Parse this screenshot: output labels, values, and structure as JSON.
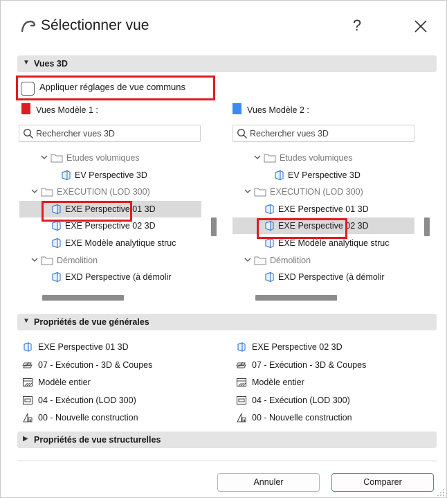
{
  "dialog": {
    "title": "Sélectionner vue",
    "help": "?"
  },
  "section_3d": {
    "label": "Vues 3D"
  },
  "checkbox": {
    "label": "Appliquer réglages de vue communs",
    "checked": false
  },
  "left": {
    "model_label": "Vues Modèle 1 :",
    "swatch_color": "#e11b22",
    "search_placeholder": "Rechercher vues 3D",
    "tree": [
      {
        "type": "folder",
        "label": "Etudes volumiques"
      },
      {
        "type": "view",
        "label": "EV Perspective 3D"
      },
      {
        "type": "folder",
        "label": "EXECUTION (LOD 300)"
      },
      {
        "type": "view",
        "label": "EXE Perspective 01 3D",
        "selected": true
      },
      {
        "type": "view",
        "label": "EXE Perspective 02 3D"
      },
      {
        "type": "view",
        "label": "EXE Modèle analytique struc"
      },
      {
        "type": "folder",
        "label": "Démolition"
      },
      {
        "type": "view",
        "label": "EXD Perspective (à démolir"
      }
    ]
  },
  "right": {
    "model_label": "Vues Modèle 2 :",
    "swatch_color": "#3b8cf0",
    "search_placeholder": "Rechercher vues 3D",
    "tree": [
      {
        "type": "folder",
        "label": "Etudes volumiques"
      },
      {
        "type": "view",
        "label": "EV Perspective 3D"
      },
      {
        "type": "folder",
        "label": "EXECUTION (LOD 300)"
      },
      {
        "type": "view",
        "label": "EXE Perspective 01 3D"
      },
      {
        "type": "view",
        "label": "EXE Perspective 02 3D",
        "selected": true
      },
      {
        "type": "view",
        "label": "EXE Modèle analytique struc"
      },
      {
        "type": "folder",
        "label": "Démolition"
      },
      {
        "type": "view",
        "label": "EXD Perspective (à démolir"
      }
    ]
  },
  "section_general": {
    "label": "Propriétés de vue générales"
  },
  "props_left": [
    {
      "icon": "view-icon",
      "label": "EXE Perspective 01 3D"
    },
    {
      "icon": "layer-combination-icon",
      "label": "07 - Exécution - 3D & Coupes"
    },
    {
      "icon": "model-view-icon",
      "label": "Modèle entier"
    },
    {
      "icon": "pen-set-icon",
      "label": "04 - Exécution (LOD 300)"
    },
    {
      "icon": "renovation-filter-icon",
      "label": "00 - Nouvelle construction"
    }
  ],
  "props_right": [
    {
      "icon": "view-icon",
      "label": "EXE Perspective 02 3D"
    },
    {
      "icon": "layer-combination-icon",
      "label": "07 - Exécution - 3D & Coupes"
    },
    {
      "icon": "model-view-icon",
      "label": "Modèle entier"
    },
    {
      "icon": "pen-set-icon",
      "label": "04 - Exécution (LOD 300)"
    },
    {
      "icon": "renovation-filter-icon",
      "label": "00 - Nouvelle construction"
    }
  ],
  "section_structural": {
    "label": "Propriétés de vue structurelles"
  },
  "buttons": {
    "cancel": "Annuler",
    "compare": "Comparer"
  },
  "colors": {
    "highlight": "#e11b22",
    "accent": "#4a88c7",
    "section_bg": "#e4e4e4"
  }
}
